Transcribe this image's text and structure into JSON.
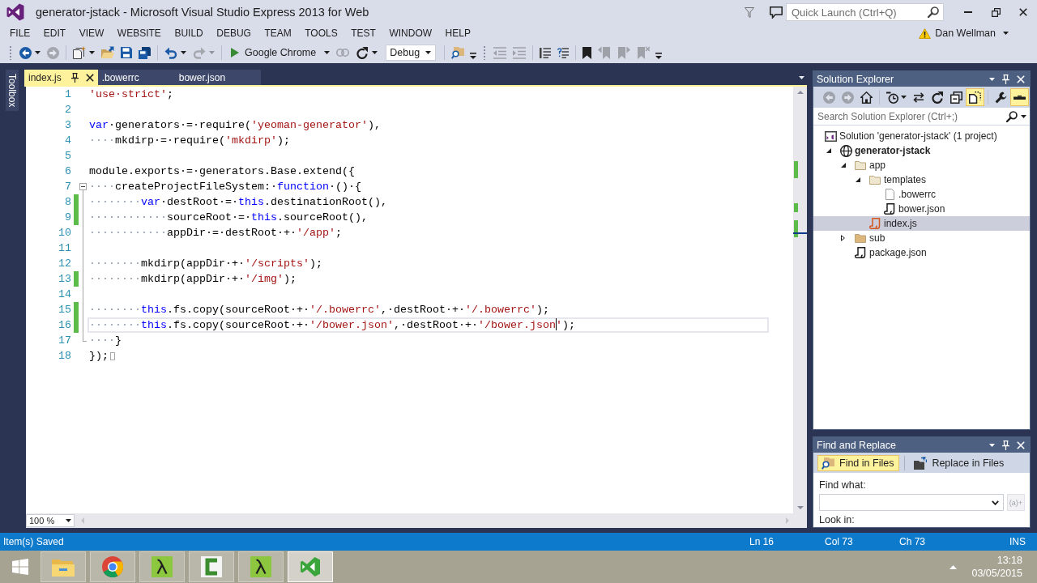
{
  "window": {
    "title": "generator-jstack - Microsoft Visual Studio Express 2013 for Web",
    "quick_launch": {
      "placeholder": "Quick Launch (Ctrl+Q)"
    }
  },
  "menu": [
    "FILE",
    "EDIT",
    "VIEW",
    "WEBSITE",
    "BUILD",
    "DEBUG",
    "TEAM",
    "TOOLS",
    "TEST",
    "WINDOW",
    "HELP"
  ],
  "user": {
    "name": "Dan Wellman",
    "warning": true
  },
  "toolbar": {
    "buttons": [
      {
        "disabled": false
      },
      {
        "disabled": true
      },
      {
        "disabled": false
      },
      {
        "disabled": false
      },
      {
        "disabled": false
      },
      {
        "disabled": false
      },
      {
        "disabled": false
      },
      {
        "disabled": true
      },
      {
        "disabled": true
      },
      {
        "disabled": false
      },
      {
        "disabled": false
      },
      {
        "disabled": true
      },
      {
        "disabled": true
      },
      {
        "disabled": false
      },
      {
        "disabled": false
      },
      {
        "disabled": false
      },
      {
        "disabled": true
      },
      {
        "disabled": true
      },
      {
        "disabled": true
      }
    ],
    "run": {
      "label": "Google Chrome"
    },
    "configuration": "Debug"
  },
  "toolbox": {
    "label": "Toolbox"
  },
  "editor": {
    "tabs": [
      {
        "label": "index.js",
        "selected": true
      },
      {
        "label": ".bowerrc",
        "selected": false
      },
      {
        "label": "bower.json",
        "selected": false
      }
    ],
    "lines": [
      {
        "number": "1",
        "changed": false,
        "current": false,
        "tokens": [
          {
            "kind": "string",
            "text": "'use·strict'"
          },
          {
            "kind": "plain",
            "text": ";"
          }
        ]
      },
      {
        "number": "2",
        "changed": false,
        "current": false
      },
      {
        "number": "3",
        "changed": false,
        "current": false,
        "tokens": [
          {
            "kind": "keyword",
            "text": "var"
          },
          {
            "kind": "plain",
            "text": "·generators·=·require("
          },
          {
            "kind": "string",
            "text": "'yeoman-generator'"
          },
          {
            "kind": "plain",
            "text": "),"
          }
        ]
      },
      {
        "number": "4",
        "changed": false,
        "current": false,
        "tokens": [
          {
            "kind": "indent",
            "text": "····"
          },
          {
            "kind": "plain",
            "text": "mkdirp·=·require("
          },
          {
            "kind": "string",
            "text": "'mkdirp'"
          },
          {
            "kind": "plain",
            "text": ");"
          }
        ]
      },
      {
        "number": "5",
        "changed": false,
        "current": false
      },
      {
        "number": "6",
        "changed": false,
        "current": false,
        "tokens": [
          {
            "kind": "plain",
            "text": "module.exports·=·generators.Base.extend({"
          }
        ]
      },
      {
        "number": "7",
        "changed": false,
        "current": false,
        "expanded": true,
        "tokens": [
          {
            "kind": "indent",
            "text": "····"
          },
          {
            "kind": "plain",
            "text": "createProjectFileSystem:·"
          },
          {
            "kind": "keyword",
            "text": "function"
          },
          {
            "kind": "plain",
            "text": "·()·{"
          }
        ],
        "children": [
          {
            "number": "8",
            "changed": true,
            "current": false,
            "tokens": [
              {
                "kind": "indent",
                "text": "········"
              },
              {
                "kind": "keyword",
                "text": "var"
              },
              {
                "kind": "plain",
                "text": "·destRoot·=·"
              },
              {
                "kind": "keyword",
                "text": "this"
              },
              {
                "kind": "plain",
                "text": ".destinationRoot(),"
              }
            ]
          },
          {
            "number": "9",
            "changed": true,
            "current": false,
            "tokens": [
              {
                "kind": "indent",
                "text": "············"
              },
              {
                "kind": "plain",
                "text": "sourceRoot·=·"
              },
              {
                "kind": "keyword",
                "text": "this"
              },
              {
                "kind": "plain",
                "text": ".sourceRoot(),"
              }
            ]
          },
          {
            "number": "10",
            "changed": false,
            "current": false,
            "tokens": [
              {
                "kind": "indent",
                "text": "············"
              },
              {
                "kind": "plain",
                "text": "appDir·=·destRoot·+·"
              },
              {
                "kind": "string",
                "text": "'/app'"
              },
              {
                "kind": "plain",
                "text": ";"
              }
            ]
          },
          {
            "number": "11",
            "changed": false,
            "current": false
          },
          {
            "number": "12",
            "changed": false,
            "current": false,
            "tokens": [
              {
                "kind": "indent",
                "text": "········"
              },
              {
                "kind": "plain",
                "text": "mkdirp(appDir·+·"
              },
              {
                "kind": "string",
                "text": "'/scripts'"
              },
              {
                "kind": "plain",
                "text": ");"
              }
            ]
          },
          {
            "number": "13",
            "changed": true,
            "current": false,
            "tokens": [
              {
                "kind": "indent",
                "text": "········"
              },
              {
                "kind": "plain",
                "text": "mkdirp(appDir·+·"
              },
              {
                "kind": "string",
                "text": "'/img'"
              },
              {
                "kind": "plain",
                "text": ");"
              }
            ]
          },
          {
            "number": "14",
            "changed": false,
            "current": false
          },
          {
            "number": "15",
            "changed": true,
            "current": false,
            "tokens": [
              {
                "kind": "indent",
                "text": "········"
              },
              {
                "kind": "keyword",
                "text": "this"
              },
              {
                "kind": "plain",
                "text": ".fs.copy(sourceRoot·+·"
              },
              {
                "kind": "string",
                "text": "'/.bowerrc'"
              },
              {
                "kind": "plain",
                "text": ",·destRoot·+·"
              },
              {
                "kind": "string",
                "text": "'/.bowerrc'"
              },
              {
                "kind": "plain",
                "text": ");"
              }
            ]
          },
          {
            "number": "16",
            "changed": true,
            "current": true,
            "tokens": [
              {
                "kind": "indent",
                "text": "········"
              },
              {
                "kind": "keyword",
                "text": "this"
              },
              {
                "kind": "plain",
                "text": ".fs.copy(sourceRoot·+·"
              },
              {
                "kind": "string",
                "text": "'/bower.json'"
              },
              {
                "kind": "plain",
                "text": ",·destRoot·+·"
              },
              {
                "kind": "string",
                "text": "'/bower.json"
              },
              {
                "kind": "caret"
              },
              {
                "kind": "string",
                "text": "'"
              },
              {
                "kind": "plain",
                "text": ");"
              }
            ]
          },
          {
            "number": "17",
            "changed": false,
            "current": false,
            "tokens": [
              {
                "kind": "indent",
                "text": "····"
              },
              {
                "kind": "plain",
                "text": "}"
              }
            ]
          }
        ]
      },
      {
        "number": "18",
        "changed": false,
        "current": false,
        "tokens": [
          {
            "kind": "plain",
            "text": "});"
          },
          {
            "kind": "eof"
          }
        ]
      }
    ],
    "zoom": "100 %"
  },
  "solution_explorer": {
    "title": "Solution Explorer",
    "toolbar": [
      {
        "disabled": true,
        "on": false
      },
      {
        "disabled": true,
        "on": false
      },
      {
        "disabled": false,
        "on": false
      },
      {
        "disabled": false,
        "on": false
      },
      {
        "disabled": false,
        "on": false
      },
      {
        "disabled": false,
        "on": false
      },
      {
        "disabled": false,
        "on": false
      },
      {
        "disabled": false,
        "on": true
      },
      {
        "disabled": false,
        "on": false
      },
      {
        "disabled": false,
        "on": true
      }
    ],
    "search": {
      "placeholder": "Search Solution Explorer (Ctrl+;)"
    },
    "tree": [
      {
        "label": "Solution 'generator-jstack' (1 project)",
        "kind": "solution",
        "selected": false,
        "children": [
          {
            "label": "generator-jstack",
            "kind": "project",
            "expanded": true,
            "selected": false,
            "children": [
              {
                "label": "app",
                "kind": "folder",
                "expanded": true,
                "selected": false,
                "children": [
                  {
                    "label": "templates",
                    "kind": "folder",
                    "expanded": true,
                    "selected": false,
                    "children": [
                      {
                        "label": ".bowerrc",
                        "kind": "file",
                        "selected": false
                      },
                      {
                        "label": "bower.json",
                        "kind": "script",
                        "selected": false
                      }
                    ]
                  },
                  {
                    "label": "index.js",
                    "kind": "script",
                    "selected": true
                  }
                ]
              },
              {
                "label": "sub",
                "kind": "folder",
                "expanded": false,
                "selected": false
              },
              {
                "label": "package.json",
                "kind": "script",
                "selected": false
              }
            ]
          }
        ]
      }
    ]
  },
  "find_and_replace": {
    "title": "Find and Replace",
    "tabs": [
      {
        "label": "Find in Files",
        "selected": true
      },
      {
        "label": "Replace in Files",
        "selected": false
      }
    ],
    "find_what": {
      "label": "Find what:"
    },
    "expression_builder": {
      "label": "(a)+",
      "disabled": true
    },
    "look_in": {
      "label": "Look in:"
    }
  },
  "status_bar": {
    "message": "Item(s) Saved",
    "line": "Ln 16",
    "column": "Col 73",
    "character": "Ch 73",
    "mode": "INS"
  },
  "taskbar": {
    "apps": [
      {
        "selected": false
      },
      {
        "selected": false
      },
      {
        "selected": false
      },
      {
        "selected": false
      },
      {
        "selected": false
      },
      {
        "selected": true
      }
    ],
    "time": "13:18",
    "date": "03/05/2015"
  }
}
